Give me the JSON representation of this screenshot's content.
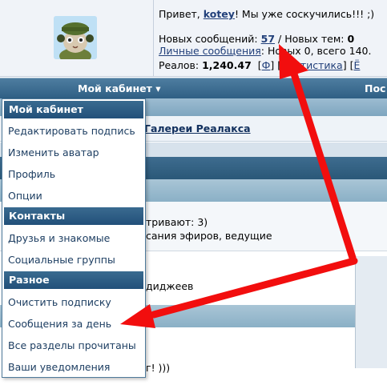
{
  "header": {
    "greeting_prefix": "Привет,",
    "username": "kotey",
    "greeting_suffix": "! Мы уже соскучились!!! ;)",
    "new_messages_label": "Новых сообщений:",
    "new_messages_count": "57",
    "new_topics_label": "/ Новых тем:",
    "new_topics_count": "0",
    "private_messages_link": "Личные сообщения",
    "private_messages_text": ": Новых 0, всего 140.",
    "reals_label": "Реалов:",
    "reals_value": "1,240.47",
    "bracket_open": "[",
    "partial_link": "Ф",
    "bracket_close": "]",
    "stats_link": "Статистика",
    "partial_link_2": "Ё"
  },
  "navbar": {
    "cabinet_label": "Мой кабинет",
    "dropdown_icon": "triangle-down",
    "next_label": "Пос"
  },
  "page": {
    "gallery_link": "Галереи Реалакса",
    "watching_text": "тривают: 3)",
    "broadcast_text": "сания эфиров, ведущие",
    "djs_text": "диджеев",
    "smile_text": "г! )))"
  },
  "dropdown": {
    "section_cabinet": "Мой кабинет",
    "edit_signature": "Редактировать подпись",
    "change_avatar": "Изменить аватар",
    "profile": "Профиль",
    "options": "Опции",
    "section_contacts": "Контакты",
    "friends": "Друзья и знакомые",
    "social_groups": "Социальные группы",
    "section_misc": "Разное",
    "clear_subscription": "Очистить подписку",
    "messages_per_day": "Сообщения за день",
    "all_read": "Все разделы прочитаны",
    "notifications": "Ваши уведомления"
  },
  "colors": {
    "arrow": "#f20e0e",
    "navbar": "#3a6b90",
    "link": "#22407a"
  }
}
